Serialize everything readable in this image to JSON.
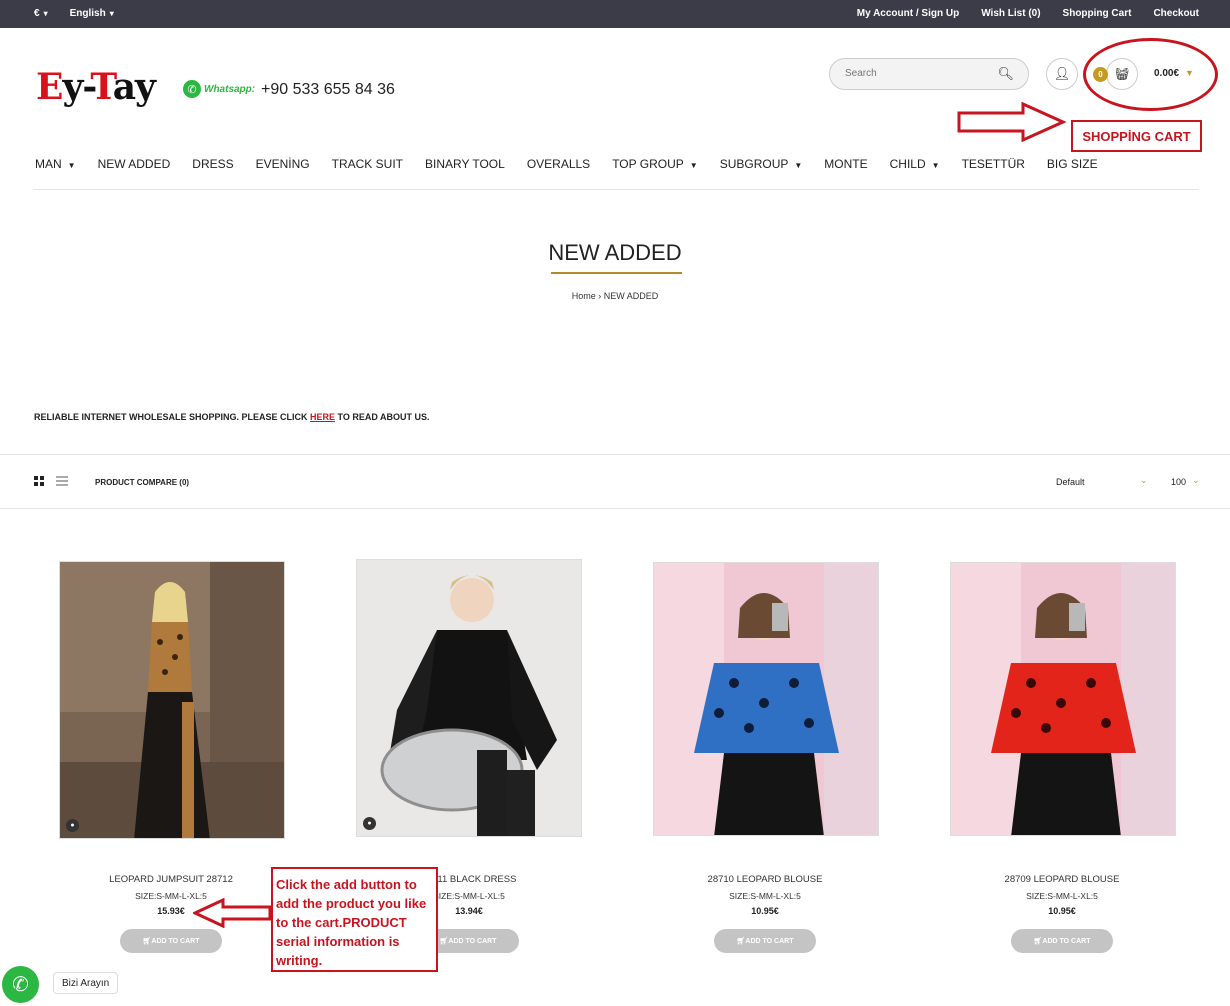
{
  "topbar": {
    "currency": "€",
    "language": "English",
    "links": [
      "My Account / Sign Up",
      "Wish List (0)",
      "Shopping Cart",
      "Checkout"
    ]
  },
  "header": {
    "logo_text": "Ey-Tay",
    "whatsapp_label": "Whatsapp:",
    "phone": "+90 533 655 84 36",
    "search_placeholder": "Search",
    "cart_count": "0",
    "cart_total": "0.00€"
  },
  "annotations": {
    "shopping_cart": "SHOPPİNG CART",
    "add_note": "Click the add button to add the product you like to the cart.PRODUCT serial information is writing."
  },
  "nav": [
    {
      "label": "MAN",
      "dropdown": true
    },
    {
      "label": "NEW ADDED",
      "dropdown": false
    },
    {
      "label": "DRESS",
      "dropdown": false
    },
    {
      "label": "EVENİNG",
      "dropdown": false
    },
    {
      "label": "TRACK SUIT",
      "dropdown": false
    },
    {
      "label": "BINARY TOOL",
      "dropdown": false
    },
    {
      "label": "OVERALLS",
      "dropdown": false
    },
    {
      "label": "TOP GROUP",
      "dropdown": true
    },
    {
      "label": "SUBGROUP",
      "dropdown": true
    },
    {
      "label": "MONTE",
      "dropdown": false
    },
    {
      "label": "CHILD",
      "dropdown": true
    },
    {
      "label": "TESETTÜR",
      "dropdown": false
    },
    {
      "label": "BIG SIZE",
      "dropdown": false
    }
  ],
  "page": {
    "title": "NEW ADDED",
    "breadcrumb_home": "Home",
    "breadcrumb_sep": "›",
    "breadcrumb_current": "NEW ADDED",
    "info_prefix": "RELIABLE INTERNET WHOLESALE SHOPPING. PLEASE CLICK ",
    "info_link": "HERE",
    "info_suffix": " TO READ ABOUT US."
  },
  "toolbar": {
    "compare": "PRODUCT COMPARE (0)",
    "sort": "Default",
    "limit": "100"
  },
  "products": [
    {
      "name": "LEOPARD JUMPSUIT 28712",
      "sizes": "SIZE:S-MM-L-XL:5",
      "price": "15.93€",
      "button": "ADD TO CART"
    },
    {
      "name": "28711 BLACK DRESS",
      "sizes": "SIZE:S-MM-L-XL:5",
      "price": "13.94€",
      "button": "ADD TO CART"
    },
    {
      "name": "28710 LEOPARD BLOUSE",
      "sizes": "SIZE:S-MM-L-XL:5",
      "price": "10.95€",
      "button": "ADD TO CART"
    },
    {
      "name": "28709 LEOPARD BLOUSE",
      "sizes": "SIZE:S-MM-L-XL:5",
      "price": "10.95€",
      "button": "ADD TO CART"
    }
  ],
  "floating": {
    "call_label": "Bizi Arayın"
  },
  "colors": {
    "topbar": "#3b3c48",
    "accent_gold": "#c49a20",
    "annotation_red": "#c8141e",
    "whatsapp_green": "#2cb742"
  }
}
